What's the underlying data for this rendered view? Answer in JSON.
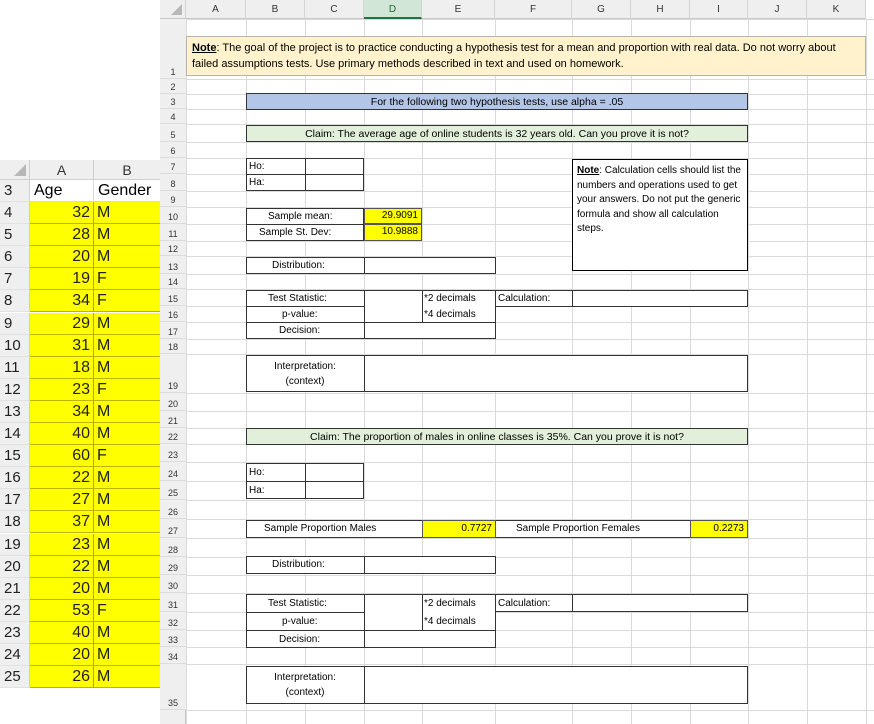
{
  "left_sheet": {
    "columns": [
      "A",
      "B"
    ],
    "header_row": {
      "row": "3",
      "age": "Age",
      "gender": "Gender"
    },
    "rows": [
      {
        "row": "4",
        "age": "32",
        "gender": "M"
      },
      {
        "row": "5",
        "age": "28",
        "gender": "M"
      },
      {
        "row": "6",
        "age": "20",
        "gender": "M"
      },
      {
        "row": "7",
        "age": "19",
        "gender": "F"
      },
      {
        "row": "8",
        "age": "34",
        "gender": "F"
      },
      {
        "row": "9",
        "age": "29",
        "gender": "M"
      },
      {
        "row": "10",
        "age": "31",
        "gender": "M"
      },
      {
        "row": "11",
        "age": "18",
        "gender": "M"
      },
      {
        "row": "12",
        "age": "23",
        "gender": "F"
      },
      {
        "row": "13",
        "age": "34",
        "gender": "M"
      },
      {
        "row": "14",
        "age": "40",
        "gender": "M"
      },
      {
        "row": "15",
        "age": "60",
        "gender": "F"
      },
      {
        "row": "16",
        "age": "22",
        "gender": "M"
      },
      {
        "row": "17",
        "age": "27",
        "gender": "M"
      },
      {
        "row": "18",
        "age": "37",
        "gender": "M"
      },
      {
        "row": "19",
        "age": "23",
        "gender": "M"
      },
      {
        "row": "20",
        "age": "22",
        "gender": "M"
      },
      {
        "row": "21",
        "age": "20",
        "gender": "M"
      },
      {
        "row": "22",
        "age": "53",
        "gender": "F"
      },
      {
        "row": "23",
        "age": "40",
        "gender": "M"
      },
      {
        "row": "24",
        "age": "20",
        "gender": "M"
      },
      {
        "row": "25",
        "age": "26",
        "gender": "M"
      }
    ]
  },
  "right_sheet": {
    "columns": [
      "A",
      "B",
      "C",
      "D",
      "E",
      "F",
      "G",
      "H",
      "I",
      "J",
      "K"
    ],
    "selected_column": "D",
    "row_numbers": [
      "1",
      "2",
      "3",
      "4",
      "5",
      "6",
      "7",
      "8",
      "9",
      "10",
      "11",
      "12",
      "13",
      "14",
      "15",
      "16",
      "17",
      "18",
      "19",
      "20",
      "21",
      "22",
      "23",
      "24",
      "25",
      "26",
      "27",
      "28",
      "29",
      "30",
      "31",
      "32",
      "33",
      "34",
      "35"
    ],
    "top_note": {
      "label": "Note",
      "text": ": The goal of the project is to practice conducting a hypothesis test for a mean and proportion with real data. Do not worry about failed assumptions tests. Use primary methods described in text and used on homework."
    },
    "alpha_banner": "For the following two hypothesis tests, use alpha = .05",
    "test1": {
      "claim": "Claim: The average age of online students is 32 years old. Can you prove it is not?",
      "ho": "Ho:",
      "ha": "Ha:",
      "sample_mean_label": "Sample mean:",
      "sample_mean_value": "29.9091",
      "sample_sd_label": "Sample St. Dev:",
      "sample_sd_value": "10.9888",
      "distribution_label": "Distribution:",
      "test_statistic_label": "Test Statistic:",
      "two_decimals": "*2 decimals",
      "calculation_label": "Calculation:",
      "p_value_label": "p-value:",
      "four_decimals": "*4 decimals",
      "decision_label": "Decision:",
      "interpretation_label": "Interpretation:",
      "context_label": "(context)"
    },
    "side_note": {
      "label": "Note",
      "text": ": Calculation cells should list the numbers and operations used to get your answers. Do not put the generic formula and show all calculation steps."
    },
    "test2": {
      "claim": "Claim: The proportion of males in online classes is 35%. Can you prove it is not?",
      "ho": "Ho:",
      "ha": "Ha:",
      "prop_males_label": "Sample Proportion Males",
      "prop_males_value": "0.7727",
      "prop_females_label": "Sample Proportion Females",
      "prop_females_value": "0.2273",
      "distribution_label": "Distribution:",
      "test_statistic_label": "Test Statistic:",
      "two_decimals": "*2 decimals",
      "calculation_label": "Calculation:",
      "p_value_label": "p-value:",
      "four_decimals": "*4 decimals",
      "decision_label": "Decision:",
      "interpretation_label": "Interpretation:",
      "context_label": "(context)"
    }
  }
}
